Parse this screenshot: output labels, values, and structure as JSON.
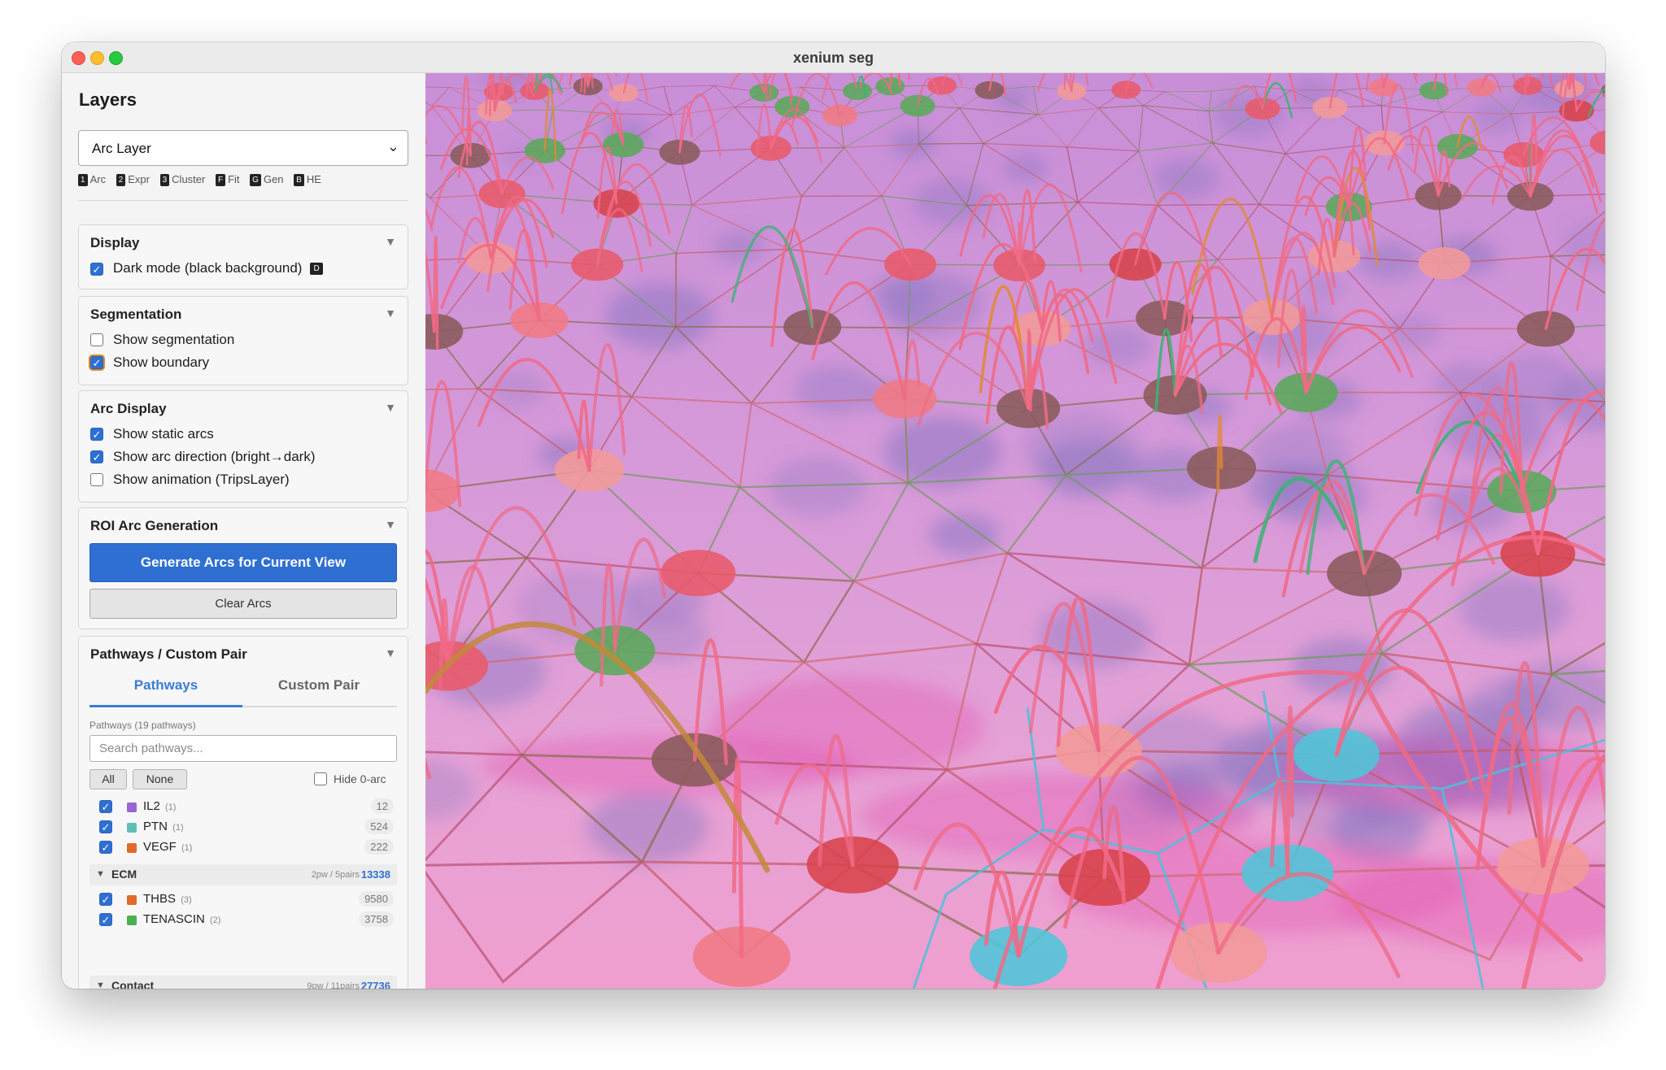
{
  "window": {
    "title": "xenium seg"
  },
  "sidebar": {
    "title": "Layers",
    "layer_select": {
      "value": "Arc Layer"
    },
    "shortcuts": [
      {
        "key": "1",
        "label": "Arc"
      },
      {
        "key": "2",
        "label": "Expr"
      },
      {
        "key": "3",
        "label": "Cluster"
      },
      {
        "key": "F",
        "label": "Fit"
      },
      {
        "key": "G",
        "label": "Gen"
      },
      {
        "key": "B",
        "label": "HE"
      }
    ],
    "display": {
      "title": "Display",
      "dark_mode": {
        "label": "Dark mode (black background)",
        "key": "D",
        "checked": true
      }
    },
    "segmentation": {
      "title": "Segmentation",
      "show_segmentation": {
        "label": "Show segmentation",
        "checked": false
      },
      "show_boundary": {
        "label": "Show boundary",
        "checked": true
      }
    },
    "arc_display": {
      "title": "Arc Display",
      "static_arcs": {
        "label": "Show static arcs",
        "checked": true
      },
      "arc_direction": {
        "label": "Show arc direction (bright→dark)",
        "checked": true
      },
      "animation": {
        "label": "Show animation (TripsLayer)",
        "checked": false
      }
    },
    "roi": {
      "title": "ROI Arc Generation",
      "generate_label": "Generate Arcs for Current View",
      "clear_label": "Clear Arcs"
    },
    "pathways": {
      "title": "Pathways / Custom Pair",
      "tabs": [
        {
          "label": "Pathways"
        },
        {
          "label": "Custom Pair"
        }
      ],
      "count_label": "Pathways (19 pathways)",
      "search_placeholder": "Search pathways...",
      "all_label": "All",
      "none_label": "None",
      "hide_zero_label": "Hide 0-arc",
      "items": [
        {
          "name": "IL2",
          "count": "(1)",
          "value": "12",
          "color": "#9a63d6"
        },
        {
          "name": "PTN",
          "count": "(1)",
          "value": "524",
          "color": "#5fbfb8"
        },
        {
          "name": "VEGF",
          "count": "(1)",
          "value": "222",
          "color": "#e06a2c"
        }
      ],
      "groups": [
        {
          "name": "ECM",
          "stats": "2pw / 5pairs",
          "total": "13338",
          "items": [
            {
              "name": "THBS",
              "count": "(3)",
              "value": "9580",
              "color": "#e06a2c"
            },
            {
              "name": "TENASCIN",
              "count": "(2)",
              "value": "3758",
              "color": "#4caf50"
            }
          ]
        },
        {
          "name": "Contact",
          "stats": "9pw / 11pairs",
          "total": "27736"
        }
      ]
    }
  },
  "viewport": {
    "colors": {
      "arc": "#f06a86",
      "arc_green": "#3cb371",
      "tissue": "#e79fd8",
      "nucleus": "#9b86c8"
    }
  }
}
